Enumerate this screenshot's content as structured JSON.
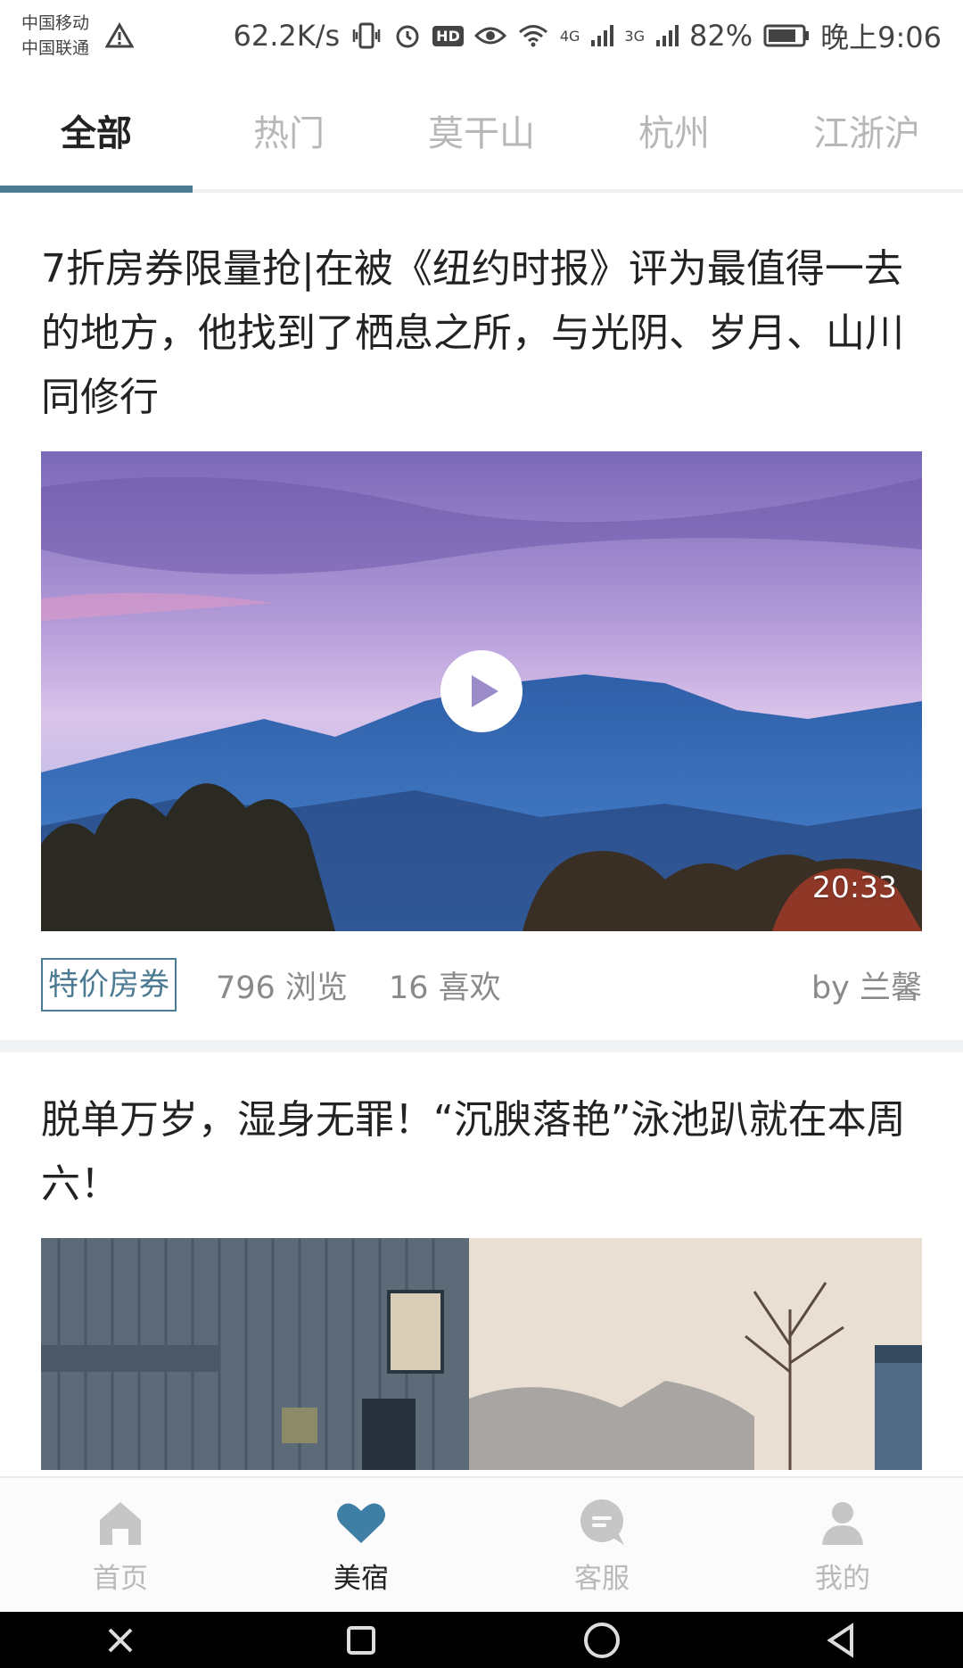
{
  "status": {
    "carrier1": "中国移动",
    "carrier2": "中国联通",
    "speed": "62.2K/s",
    "hd": "HD",
    "net4g": "4G",
    "net3g": "3G",
    "battery": "82%",
    "time": "晚上9:06"
  },
  "tabs": [
    {
      "label": "全部"
    },
    {
      "label": "热门"
    },
    {
      "label": "莫干山"
    },
    {
      "label": "杭州"
    },
    {
      "label": "江浙沪"
    }
  ],
  "cards": [
    {
      "title": "7折房券限量抢|在被《纽约时报》评为最值得一去的地方，他找到了栖息之所，与光阴、岁月、山川同修行",
      "duration": "20:33",
      "tag": "特价房券",
      "views": "796 浏览",
      "likes": "16 喜欢",
      "author": "by 兰馨"
    },
    {
      "title": "脱单万岁，湿身无罪！“沉腴落艳”泳池趴就在本周六！"
    }
  ],
  "nav": [
    {
      "label": "首页",
      "icon": "home-icon"
    },
    {
      "label": "美宿",
      "icon": "heart-icon"
    },
    {
      "label": "客服",
      "icon": "chat-icon"
    },
    {
      "label": "我的",
      "icon": "person-icon"
    }
  ],
  "colors": {
    "accent": "#4c7a93",
    "inactive": "#b9b9b9"
  }
}
